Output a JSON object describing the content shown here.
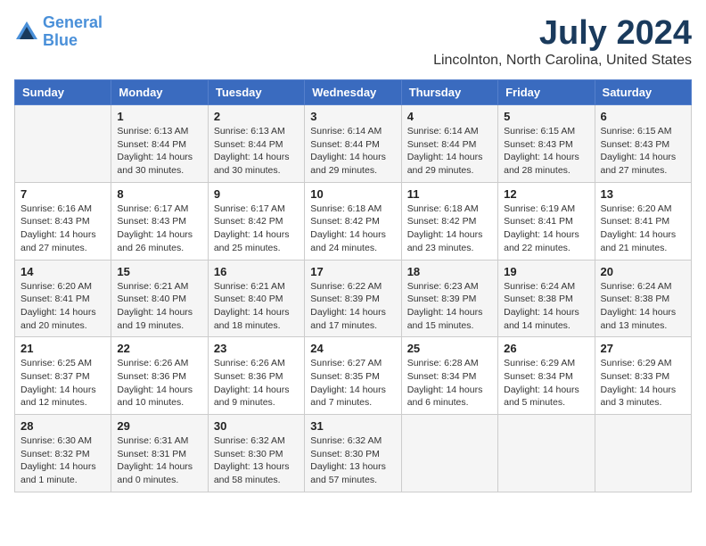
{
  "header": {
    "logo_line1": "General",
    "logo_line2": "Blue",
    "month": "July 2024",
    "location": "Lincolnton, North Carolina, United States"
  },
  "weekdays": [
    "Sunday",
    "Monday",
    "Tuesday",
    "Wednesday",
    "Thursday",
    "Friday",
    "Saturday"
  ],
  "weeks": [
    [
      {
        "num": "",
        "info": ""
      },
      {
        "num": "1",
        "info": "Sunrise: 6:13 AM\nSunset: 8:44 PM\nDaylight: 14 hours\nand 30 minutes."
      },
      {
        "num": "2",
        "info": "Sunrise: 6:13 AM\nSunset: 8:44 PM\nDaylight: 14 hours\nand 30 minutes."
      },
      {
        "num": "3",
        "info": "Sunrise: 6:14 AM\nSunset: 8:44 PM\nDaylight: 14 hours\nand 29 minutes."
      },
      {
        "num": "4",
        "info": "Sunrise: 6:14 AM\nSunset: 8:44 PM\nDaylight: 14 hours\nand 29 minutes."
      },
      {
        "num": "5",
        "info": "Sunrise: 6:15 AM\nSunset: 8:43 PM\nDaylight: 14 hours\nand 28 minutes."
      },
      {
        "num": "6",
        "info": "Sunrise: 6:15 AM\nSunset: 8:43 PM\nDaylight: 14 hours\nand 27 minutes."
      }
    ],
    [
      {
        "num": "7",
        "info": "Sunrise: 6:16 AM\nSunset: 8:43 PM\nDaylight: 14 hours\nand 27 minutes."
      },
      {
        "num": "8",
        "info": "Sunrise: 6:17 AM\nSunset: 8:43 PM\nDaylight: 14 hours\nand 26 minutes."
      },
      {
        "num": "9",
        "info": "Sunrise: 6:17 AM\nSunset: 8:42 PM\nDaylight: 14 hours\nand 25 minutes."
      },
      {
        "num": "10",
        "info": "Sunrise: 6:18 AM\nSunset: 8:42 PM\nDaylight: 14 hours\nand 24 minutes."
      },
      {
        "num": "11",
        "info": "Sunrise: 6:18 AM\nSunset: 8:42 PM\nDaylight: 14 hours\nand 23 minutes."
      },
      {
        "num": "12",
        "info": "Sunrise: 6:19 AM\nSunset: 8:41 PM\nDaylight: 14 hours\nand 22 minutes."
      },
      {
        "num": "13",
        "info": "Sunrise: 6:20 AM\nSunset: 8:41 PM\nDaylight: 14 hours\nand 21 minutes."
      }
    ],
    [
      {
        "num": "14",
        "info": "Sunrise: 6:20 AM\nSunset: 8:41 PM\nDaylight: 14 hours\nand 20 minutes."
      },
      {
        "num": "15",
        "info": "Sunrise: 6:21 AM\nSunset: 8:40 PM\nDaylight: 14 hours\nand 19 minutes."
      },
      {
        "num": "16",
        "info": "Sunrise: 6:21 AM\nSunset: 8:40 PM\nDaylight: 14 hours\nand 18 minutes."
      },
      {
        "num": "17",
        "info": "Sunrise: 6:22 AM\nSunset: 8:39 PM\nDaylight: 14 hours\nand 17 minutes."
      },
      {
        "num": "18",
        "info": "Sunrise: 6:23 AM\nSunset: 8:39 PM\nDaylight: 14 hours\nand 15 minutes."
      },
      {
        "num": "19",
        "info": "Sunrise: 6:24 AM\nSunset: 8:38 PM\nDaylight: 14 hours\nand 14 minutes."
      },
      {
        "num": "20",
        "info": "Sunrise: 6:24 AM\nSunset: 8:38 PM\nDaylight: 14 hours\nand 13 minutes."
      }
    ],
    [
      {
        "num": "21",
        "info": "Sunrise: 6:25 AM\nSunset: 8:37 PM\nDaylight: 14 hours\nand 12 minutes."
      },
      {
        "num": "22",
        "info": "Sunrise: 6:26 AM\nSunset: 8:36 PM\nDaylight: 14 hours\nand 10 minutes."
      },
      {
        "num": "23",
        "info": "Sunrise: 6:26 AM\nSunset: 8:36 PM\nDaylight: 14 hours\nand 9 minutes."
      },
      {
        "num": "24",
        "info": "Sunrise: 6:27 AM\nSunset: 8:35 PM\nDaylight: 14 hours\nand 7 minutes."
      },
      {
        "num": "25",
        "info": "Sunrise: 6:28 AM\nSunset: 8:34 PM\nDaylight: 14 hours\nand 6 minutes."
      },
      {
        "num": "26",
        "info": "Sunrise: 6:29 AM\nSunset: 8:34 PM\nDaylight: 14 hours\nand 5 minutes."
      },
      {
        "num": "27",
        "info": "Sunrise: 6:29 AM\nSunset: 8:33 PM\nDaylight: 14 hours\nand 3 minutes."
      }
    ],
    [
      {
        "num": "28",
        "info": "Sunrise: 6:30 AM\nSunset: 8:32 PM\nDaylight: 14 hours\nand 1 minute."
      },
      {
        "num": "29",
        "info": "Sunrise: 6:31 AM\nSunset: 8:31 PM\nDaylight: 14 hours\nand 0 minutes."
      },
      {
        "num": "30",
        "info": "Sunrise: 6:32 AM\nSunset: 8:30 PM\nDaylight: 13 hours\nand 58 minutes."
      },
      {
        "num": "31",
        "info": "Sunrise: 6:32 AM\nSunset: 8:30 PM\nDaylight: 13 hours\nand 57 minutes."
      },
      {
        "num": "",
        "info": ""
      },
      {
        "num": "",
        "info": ""
      },
      {
        "num": "",
        "info": ""
      }
    ]
  ]
}
